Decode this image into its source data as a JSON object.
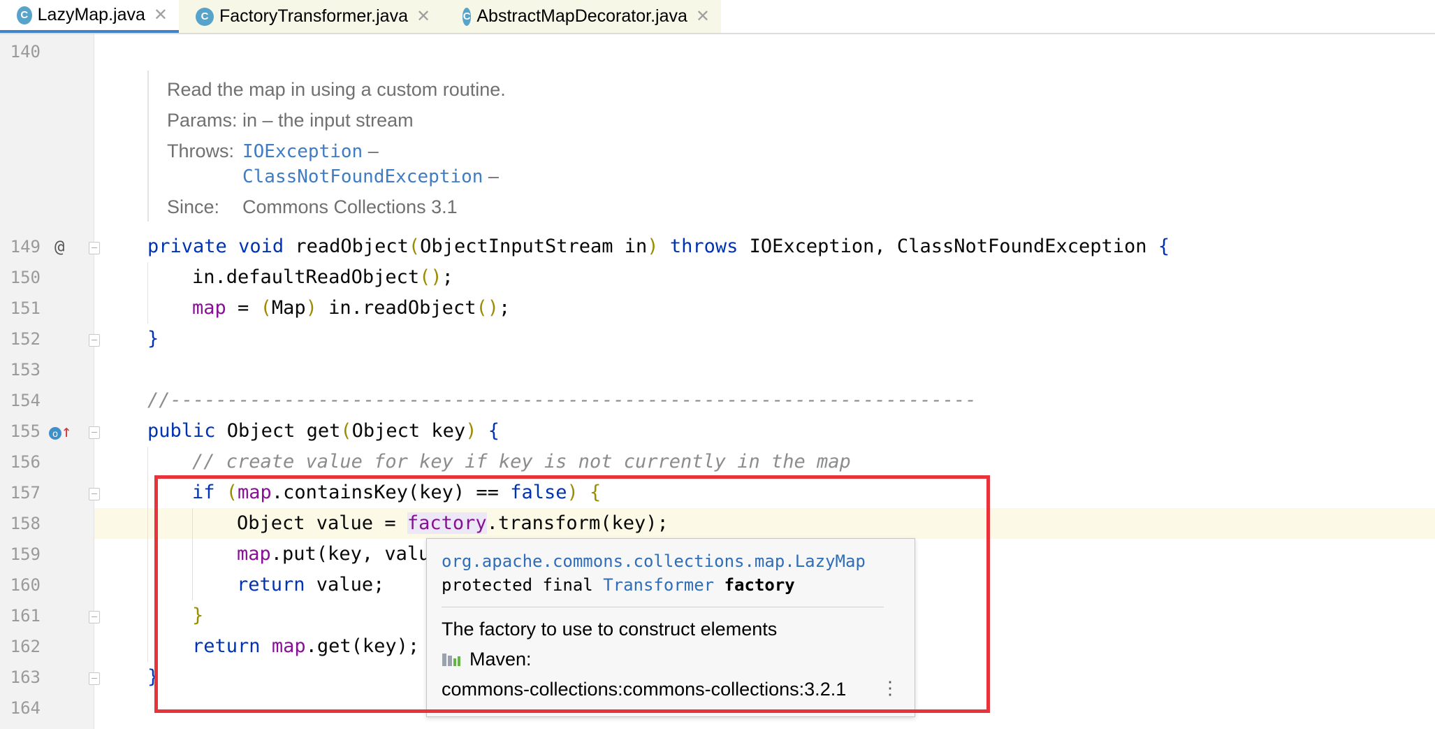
{
  "tabs": [
    {
      "label": "LazyMap.java",
      "icon": "C",
      "active": true
    },
    {
      "label": "FactoryTransformer.java",
      "icon": "C",
      "active": false
    },
    {
      "label": "AbstractMapDecorator.java",
      "icon": "C",
      "active": false
    }
  ],
  "gutter": {
    "line_numbers": [
      "140",
      "149",
      "150",
      "151",
      "152",
      "153",
      "154",
      "155",
      "156",
      "157",
      "158",
      "159",
      "160",
      "161",
      "162",
      "163",
      "164"
    ],
    "markers": {
      "override_at": "@",
      "implements_icon": "o↑"
    }
  },
  "doc": {
    "summary": "Read the map in using a custom routine.",
    "params_label": "Params:",
    "params_value": "in – the input stream",
    "throws_label": "Throws:",
    "throws_1": "IOException",
    "throws_2": "ClassNotFoundException",
    "dash": "–",
    "since_label": "Since:",
    "since_value": "Commons Collections 3.1"
  },
  "code": {
    "l149": {
      "kw1": "private",
      "kw2": "void",
      "name": " readObject",
      "p_open": "(",
      "params": "ObjectInputStream in",
      "p_close": ")",
      "kw3": "throws",
      "rest": " IOException, ClassNotFoundException ",
      "brace": "{"
    },
    "l150": {
      "text": "in.defaultReadObject",
      "parens": "()",
      "semi": ";"
    },
    "l151": {
      "fld": "map",
      "mid": " = ",
      "p_open": "(",
      "cast": "Map",
      "p_close": ")",
      "rest": " in.readObject",
      "parens": "()",
      "semi": ";"
    },
    "l152": {
      "text": "}"
    },
    "l154": {
      "comment": "//-----------------------------------------------------------------------"
    },
    "l155": {
      "kw": "public",
      "rest1": " Object get",
      "p_open": "(",
      "params": "Object key",
      "p_close": ")",
      "brace": "{"
    },
    "l156": {
      "comment": "// create value for key if key is not currently in the map"
    },
    "l157": {
      "kw": "if",
      "p_open": "(",
      "fld": "map",
      "rest": ".containsKey(key) == ",
      "kw2": "false",
      "p_close": ")",
      "brace": "{"
    },
    "l158": {
      "pre": "Object value = ",
      "fld": "factory",
      "rest": ".transform(key);"
    },
    "l159": {
      "fld": "map",
      "rest": ".put(key, valu"
    },
    "l160": {
      "kw": "return",
      "rest": " value;"
    },
    "l161": {
      "text": "}"
    },
    "l162": {
      "kw": "return",
      "fld": "map",
      "rest": ".get(key);"
    },
    "l163": {
      "text": "}"
    }
  },
  "popup": {
    "qualified_class": "org.apache.commons.collections.map.LazyMap",
    "modifiers": "protected final ",
    "type": "Transformer",
    "field_name": "factory",
    "description": "The factory to use to construct elements",
    "maven_label": "Maven:",
    "artifact": "commons-collections:commons-collections:3.2.1",
    "more_icon": "⋮"
  },
  "colors": {
    "keyword": "#0033b3",
    "field": "#871094",
    "comment": "#8c8c8c",
    "annotation_box": "#e8333a",
    "current_line": "#fcfae6"
  }
}
